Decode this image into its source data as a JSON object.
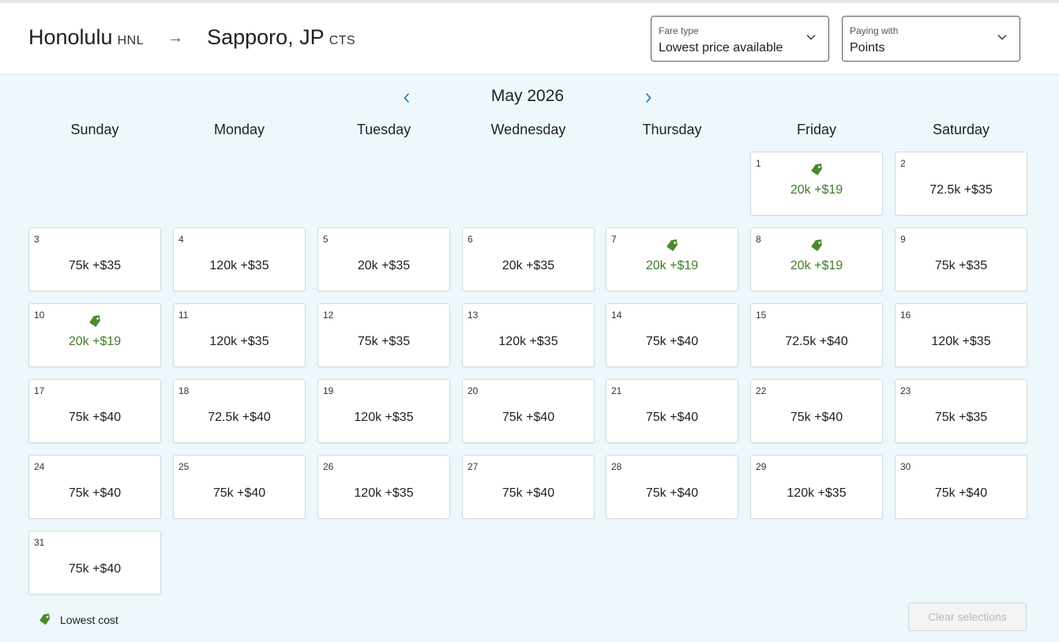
{
  "route": {
    "origin_city": "Honolulu",
    "origin_code": "HNL",
    "destination_city": "Sapporo, JP",
    "destination_code": "CTS"
  },
  "fare_type": {
    "label": "Fare type",
    "value": "Lowest price available"
  },
  "paying_with": {
    "label": "Paying with",
    "value": "Points"
  },
  "calendar": {
    "month_title": "May 2026",
    "weekdays": [
      "Sunday",
      "Monday",
      "Tuesday",
      "Wednesday",
      "Thursday",
      "Friday",
      "Saturday"
    ],
    "first_weekday_index": 5,
    "days": [
      {
        "day": "1",
        "price": "20k +$19",
        "lowest": true
      },
      {
        "day": "2",
        "price": "72.5k +$35",
        "lowest": false
      },
      {
        "day": "3",
        "price": "75k +$35",
        "lowest": false
      },
      {
        "day": "4",
        "price": "120k +$35",
        "lowest": false
      },
      {
        "day": "5",
        "price": "20k +$35",
        "lowest": false
      },
      {
        "day": "6",
        "price": "20k +$35",
        "lowest": false
      },
      {
        "day": "7",
        "price": "20k +$19",
        "lowest": true
      },
      {
        "day": "8",
        "price": "20k +$19",
        "lowest": true
      },
      {
        "day": "9",
        "price": "75k +$35",
        "lowest": false
      },
      {
        "day": "10",
        "price": "20k +$19",
        "lowest": true
      },
      {
        "day": "11",
        "price": "120k +$35",
        "lowest": false
      },
      {
        "day": "12",
        "price": "75k +$35",
        "lowest": false
      },
      {
        "day": "13",
        "price": "120k +$35",
        "lowest": false
      },
      {
        "day": "14",
        "price": "75k +$40",
        "lowest": false
      },
      {
        "day": "15",
        "price": "72.5k +$40",
        "lowest": false
      },
      {
        "day": "16",
        "price": "120k +$35",
        "lowest": false
      },
      {
        "day": "17",
        "price": "75k +$40",
        "lowest": false
      },
      {
        "day": "18",
        "price": "72.5k +$40",
        "lowest": false
      },
      {
        "day": "19",
        "price": "120k +$35",
        "lowest": false
      },
      {
        "day": "20",
        "price": "75k +$40",
        "lowest": false
      },
      {
        "day": "21",
        "price": "75k +$40",
        "lowest": false
      },
      {
        "day": "22",
        "price": "75k +$40",
        "lowest": false
      },
      {
        "day": "23",
        "price": "75k +$35",
        "lowest": false
      },
      {
        "day": "24",
        "price": "75k +$40",
        "lowest": false
      },
      {
        "day": "25",
        "price": "75k +$40",
        "lowest": false
      },
      {
        "day": "26",
        "price": "120k +$35",
        "lowest": false
      },
      {
        "day": "27",
        "price": "75k +$40",
        "lowest": false
      },
      {
        "day": "28",
        "price": "75k +$40",
        "lowest": false
      },
      {
        "day": "29",
        "price": "120k +$35",
        "lowest": false
      },
      {
        "day": "30",
        "price": "75k +$40",
        "lowest": false
      },
      {
        "day": "31",
        "price": "75k +$40",
        "lowest": false
      }
    ]
  },
  "legend": {
    "label": "Lowest cost",
    "icon": "price-tag-icon"
  },
  "clear_button": {
    "label": "Clear selections",
    "disabled": true
  },
  "colors": {
    "lowest_price": "#3f7a2c",
    "tag_icon": "#4a8a2f",
    "accent": "#2a6fa8",
    "page_background": "#eef8fc"
  }
}
